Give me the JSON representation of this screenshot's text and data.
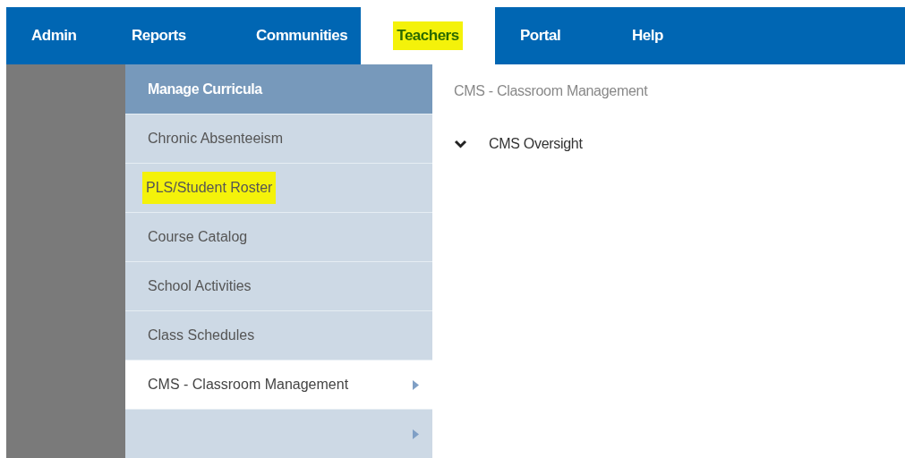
{
  "tabs": [
    {
      "label": "Admin",
      "selected": false,
      "highlighted": false
    },
    {
      "label": "Reports",
      "selected": false,
      "highlighted": false
    },
    {
      "label": "Communities",
      "selected": false,
      "highlighted": false
    },
    {
      "label": "Teachers",
      "selected": true,
      "highlighted": true
    },
    {
      "label": "Portal",
      "selected": false,
      "highlighted": false
    },
    {
      "label": "Help",
      "selected": false,
      "highlighted": false
    }
  ],
  "menu": {
    "header": "Manage Curricula",
    "items": [
      {
        "label": "Chronic Absenteeism",
        "selected": false,
        "highlighted": false,
        "submenu": false
      },
      {
        "label": "PLS/Student Roster",
        "selected": false,
        "highlighted": true,
        "submenu": false
      },
      {
        "label": "Course Catalog",
        "selected": false,
        "highlighted": false,
        "submenu": false
      },
      {
        "label": "School Activities",
        "selected": false,
        "highlighted": false,
        "submenu": false
      },
      {
        "label": "Class Schedules",
        "selected": false,
        "highlighted": false,
        "submenu": false
      },
      {
        "label": "CMS - Classroom Management",
        "selected": true,
        "highlighted": false,
        "submenu": true
      },
      {
        "selected": false,
        "highlighted": false,
        "submenu": true
      }
    ]
  },
  "panel": {
    "title": "CMS - Classroom Management",
    "items": [
      {
        "label": "CMS Oversight",
        "expanded": true
      }
    ]
  }
}
